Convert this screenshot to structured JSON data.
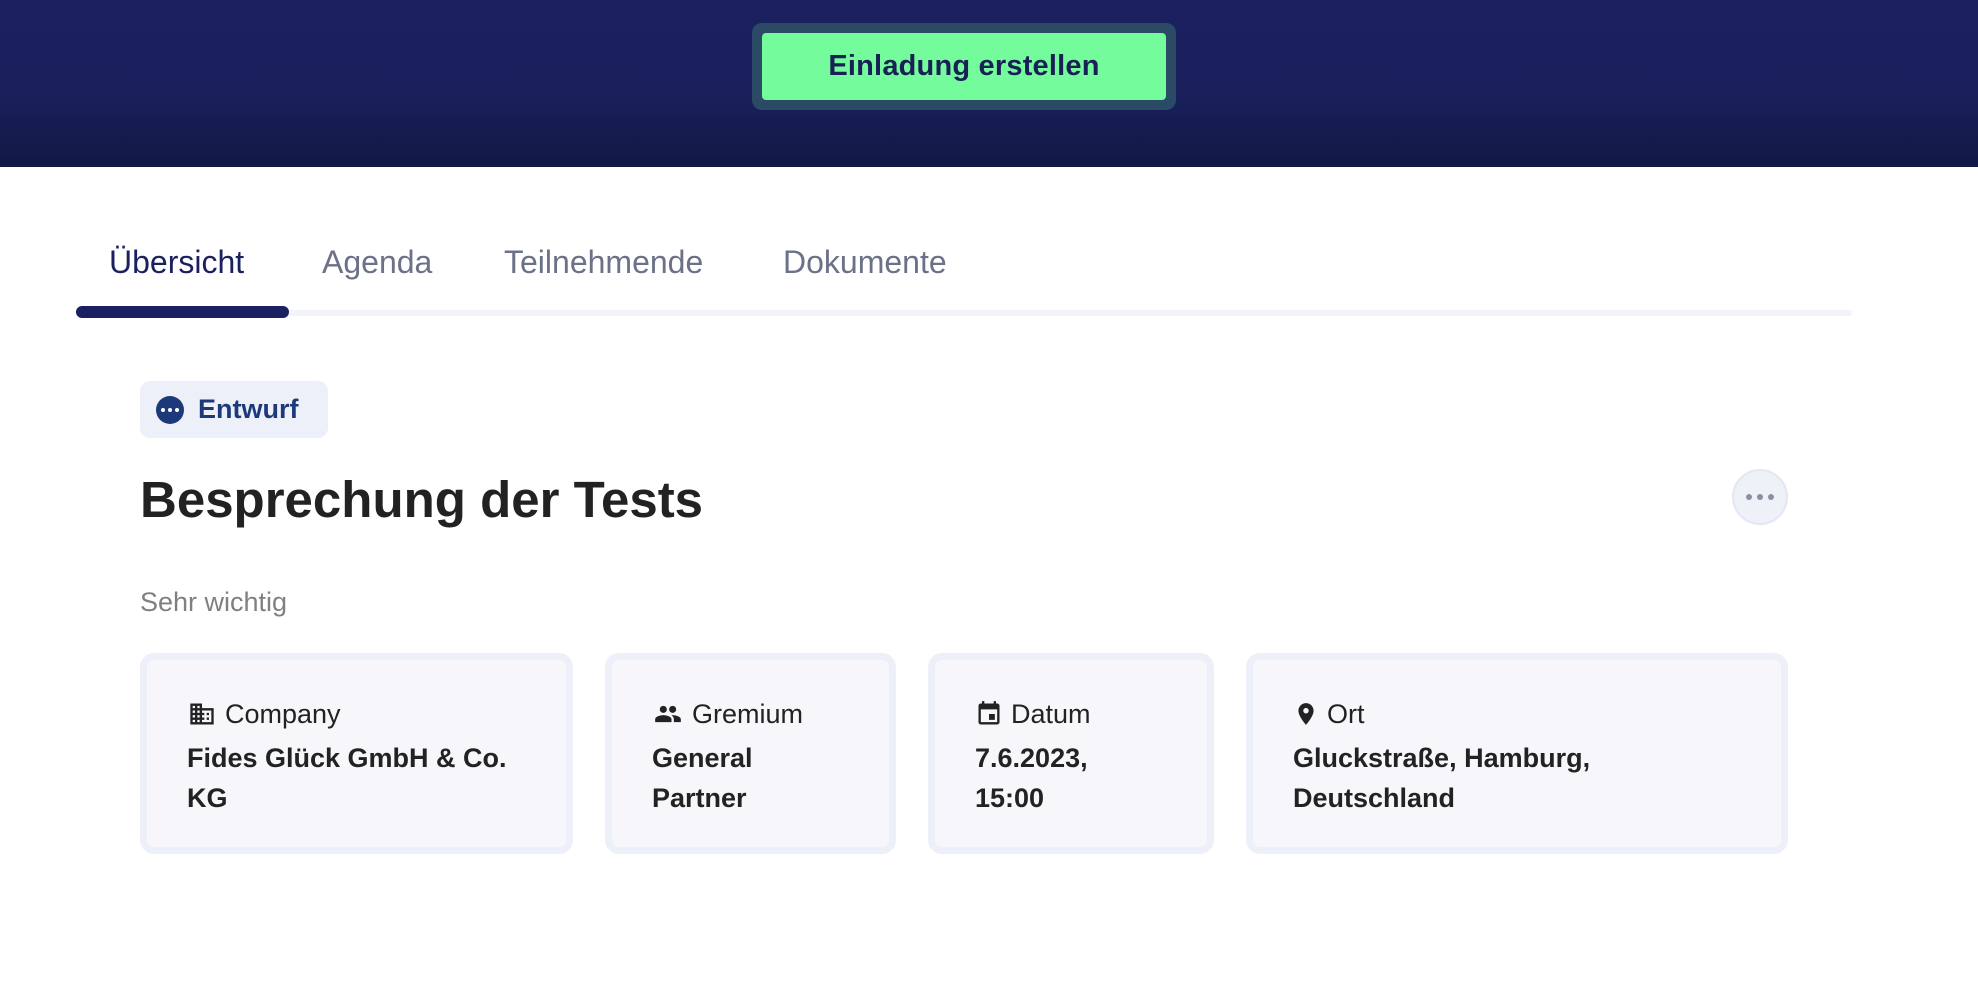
{
  "header": {
    "cta_label": "Einladung erstellen",
    "background_color": "#1b2160",
    "cta_color": "#74fb9c"
  },
  "tabs": [
    {
      "label": "Übersicht",
      "active": true
    },
    {
      "label": "Agenda",
      "active": false
    },
    {
      "label": "Teilnehmende",
      "active": false
    },
    {
      "label": "Dokumente",
      "active": false
    }
  ],
  "status": {
    "label": "Entwurf",
    "icon": "more-horizontal-circle-icon",
    "color": "#1c3a7a"
  },
  "meeting": {
    "title": "Besprechung der Tests",
    "description": "Sehr wichtig",
    "more_icon": "more-horizontal-icon"
  },
  "cards": [
    {
      "icon": "building-icon",
      "label": "Company",
      "value": "Fides Glück GmbH & Co. KG"
    },
    {
      "icon": "people-icon",
      "label": "Gremium",
      "value": "General Partner"
    },
    {
      "icon": "calendar-icon",
      "label": "Datum",
      "value": "7.6.2023, 15:00"
    },
    {
      "icon": "location-pin-icon",
      "label": "Ort",
      "value": "Gluckstraße, Hamburg, Deutschland"
    }
  ]
}
